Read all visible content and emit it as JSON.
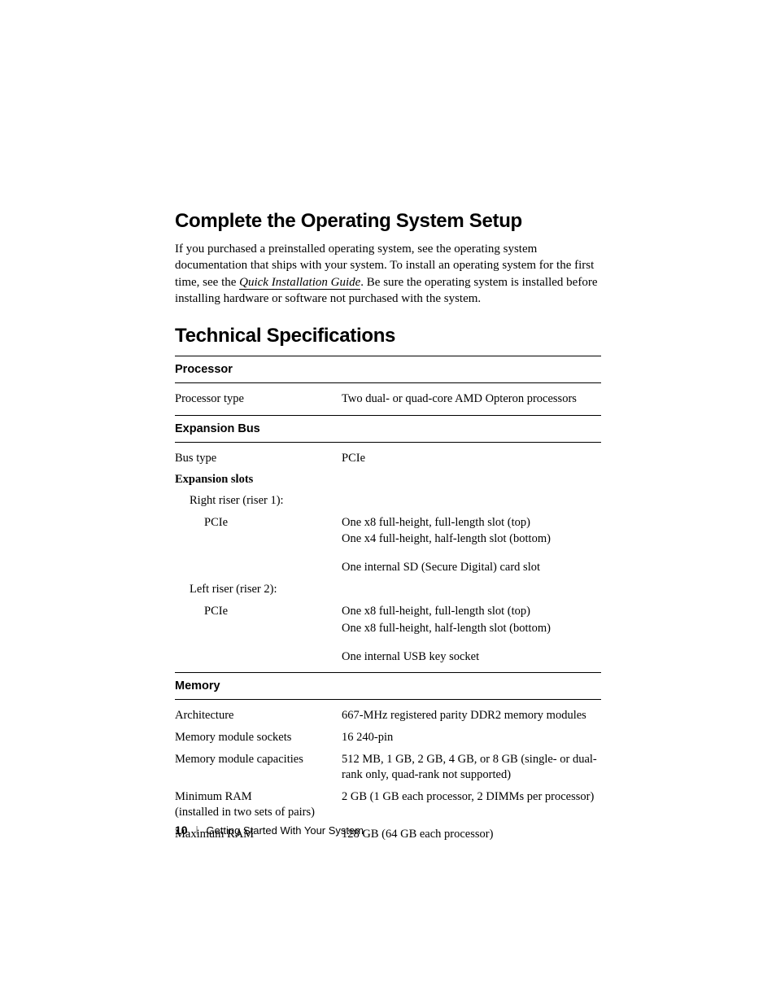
{
  "headings": {
    "h1": "Complete the Operating System Setup",
    "h2": "Technical Specifications"
  },
  "paragraph": {
    "part1": "If you purchased a preinstalled operating system, see the operating system documentation that ships with your system. To install an operating system for the first time, see the ",
    "link": "Quick Installation Guide",
    "part2": ". Be sure the operating system is installed before installing hardware or software not purchased with the system."
  },
  "sections": {
    "processor": {
      "title": "Processor",
      "rows": {
        "type_label": "Processor type",
        "type_value": "Two dual- or quad-core AMD Opteron processors"
      }
    },
    "expansion": {
      "title": "Expansion Bus",
      "bus_label": "Bus type",
      "bus_value": "PCIe",
      "slots_header": "Expansion slots",
      "riser1_label": "Right riser (riser 1):",
      "riser1_pcie_label": "PCIe",
      "riser1_pcie_line1": "One x8 full-height, full-length slot (top)",
      "riser1_pcie_line2": "One x4 full-height, half-length slot (bottom)",
      "riser1_extra": "One internal SD (Secure Digital) card slot",
      "riser2_label": "Left riser (riser 2):",
      "riser2_pcie_label": "PCIe",
      "riser2_pcie_line1": "One x8 full-height, full-length slot (top)",
      "riser2_pcie_line2": "One x8 full-height, half-length slot (bottom)",
      "riser2_extra": "One internal USB key socket"
    },
    "memory": {
      "title": "Memory",
      "arch_label": "Architecture",
      "arch_value": "667-MHz registered parity DDR2 memory modules",
      "sockets_label": "Memory module sockets",
      "sockets_value": "16 240-pin",
      "capacities_label": "Memory module capacities",
      "capacities_value": "512 MB, 1 GB, 2 GB, 4 GB, or 8 GB (single- or dual-rank only, quad-rank not supported)",
      "min_label_line1": "Minimum RAM",
      "min_label_line2": "(installed in two sets of pairs)",
      "min_value": "2 GB (1 GB each processor, 2 DIMMs per processor)",
      "max_label": "Maximum RAM",
      "max_value": "128 GB (64 GB each processor)"
    }
  },
  "footer": {
    "page": "10",
    "chapter": "Getting Started With Your System"
  }
}
